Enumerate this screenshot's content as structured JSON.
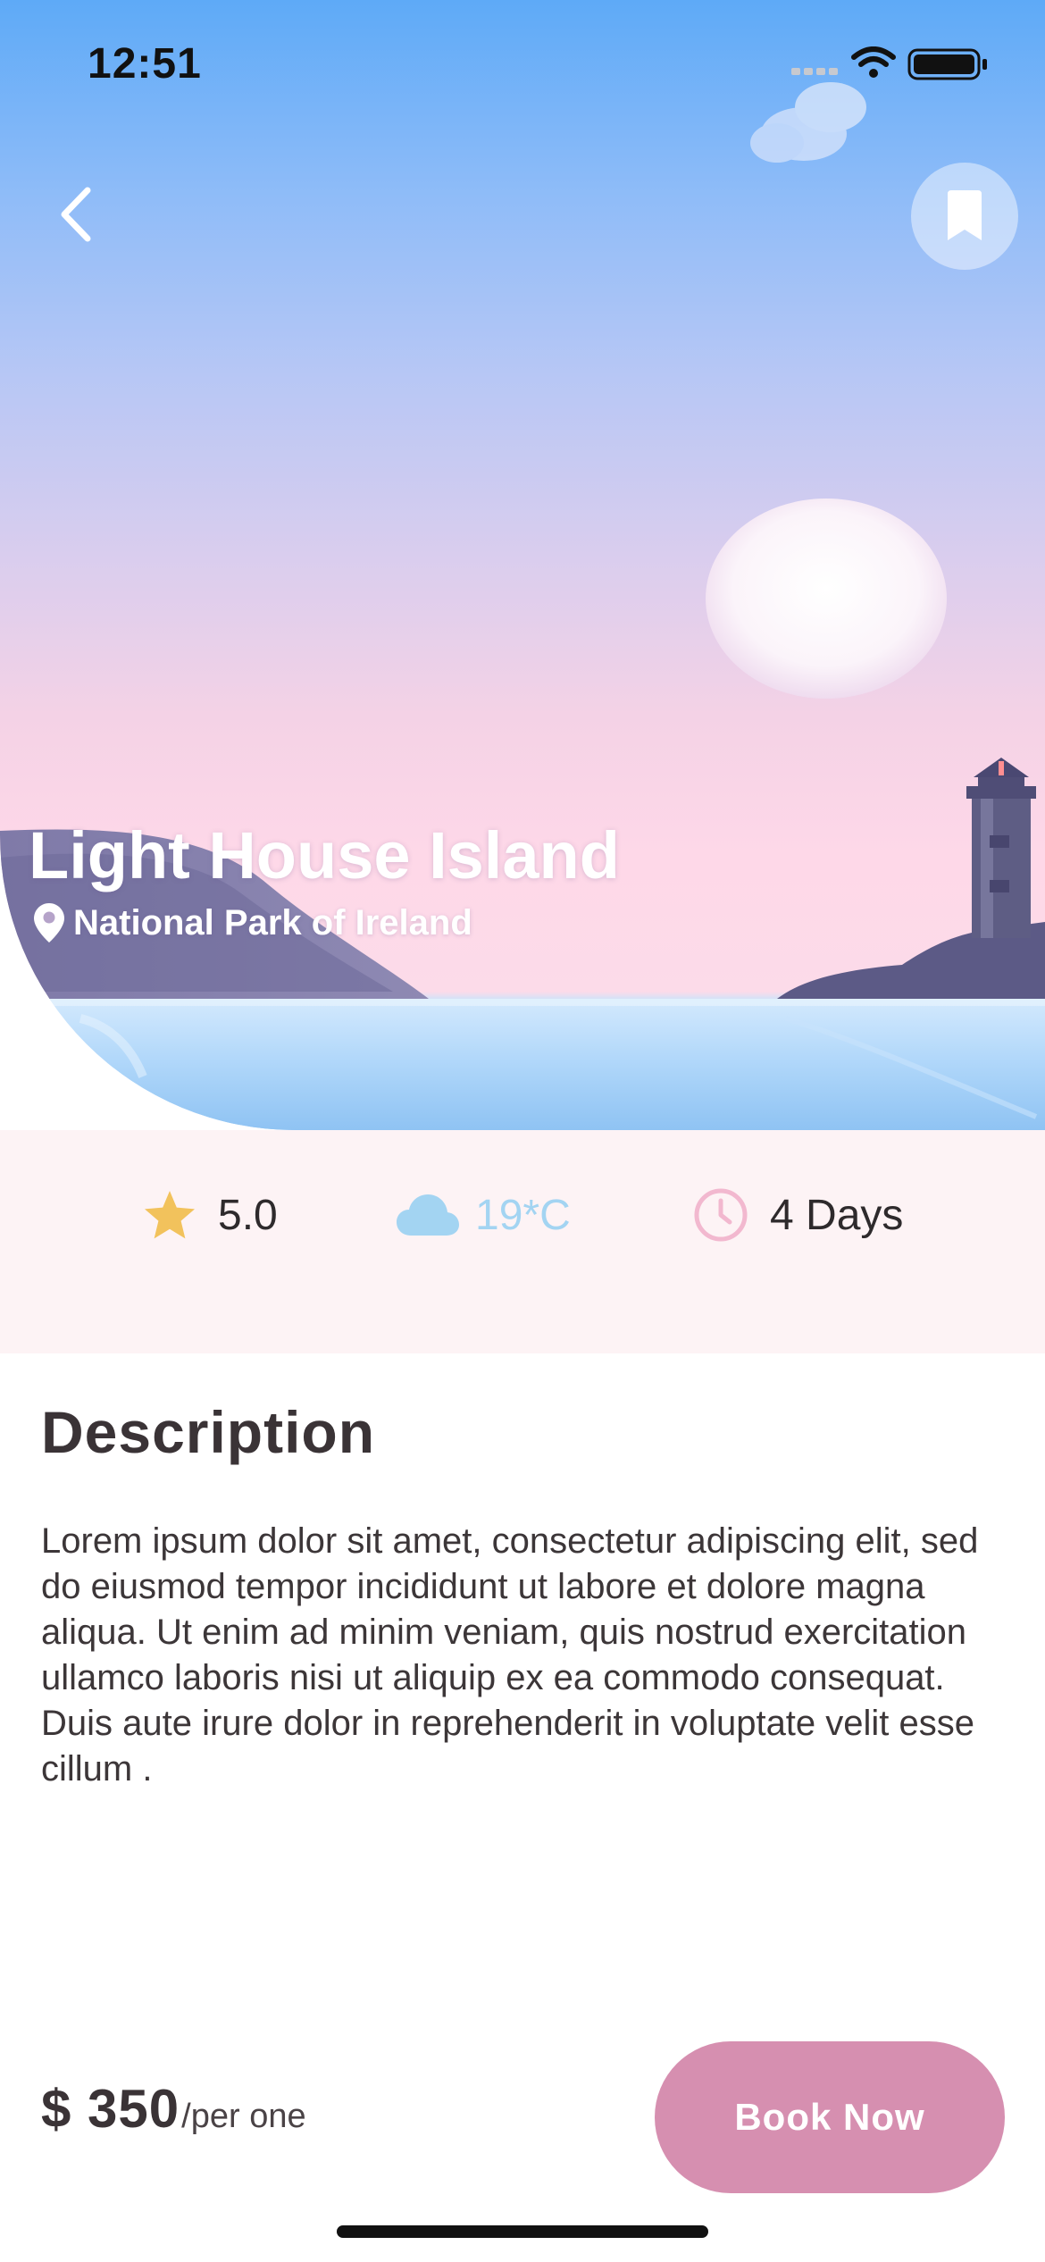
{
  "status_bar": {
    "time": "12:51"
  },
  "navigation": {
    "back_icon": "chevron-left-icon",
    "bookmark_icon": "bookmark-icon"
  },
  "place": {
    "title": "Light House Island",
    "location": "National Park of Ireland",
    "location_icon": "map-pin-icon"
  },
  "stats": [
    {
      "icon": "star-icon",
      "value": "5.0",
      "icon_color": "#f2c25c",
      "text_color": "#2e2a2c"
    },
    {
      "icon": "cloud-icon",
      "value": "19*C",
      "icon_color": "#a3d4f2",
      "text_color": "#a3d4f2"
    },
    {
      "icon": "clock-icon",
      "value": "4 Days",
      "icon_color": "#f2b8cf",
      "text_color": "#2e2a2c"
    }
  ],
  "description": {
    "heading": "Description",
    "body": "Lorem ipsum dolor sit amet, consectetur adipiscing elit, sed do eiusmod tempor incididunt ut labore et dolore magna aliqua. Ut enim ad minim veniam, quis nostrud exercitation ullamco laboris nisi ut aliquip ex ea commodo consequat. Duis aute irure dolor in reprehenderit in voluptate velit esse cillum ."
  },
  "footer": {
    "price": "$ 350",
    "price_unit": "/per one",
    "book_label": "Book Now"
  },
  "colors": {
    "accent": "#d68fb0",
    "band_background": "#fdf3f5"
  }
}
